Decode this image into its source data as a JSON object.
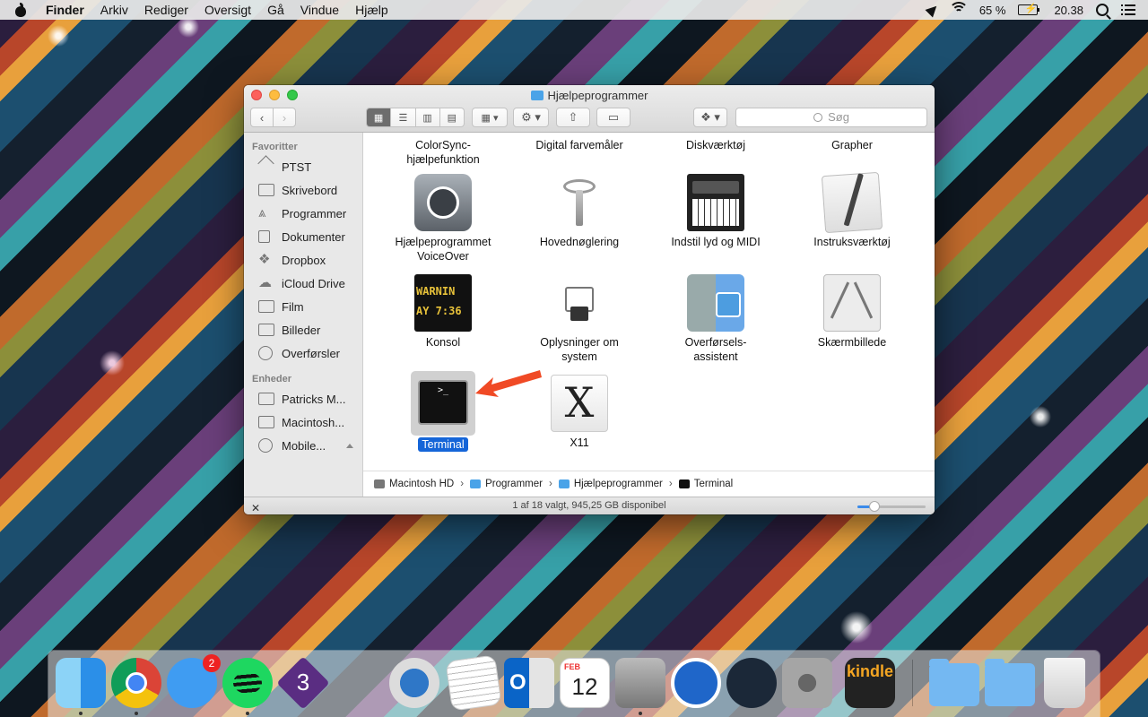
{
  "menubar": {
    "app": "Finder",
    "items": [
      "Arkiv",
      "Rediger",
      "Oversigt",
      "Gå",
      "Vindue",
      "Hjælp"
    ],
    "battery": "65 %",
    "time": "20.38"
  },
  "window": {
    "title": "Hjælpeprogrammer",
    "search_placeholder": "Søg",
    "sidebar": {
      "favorites_header": "Favoritter",
      "favorites": [
        {
          "label": "PTST",
          "icon": "home-icon"
        },
        {
          "label": "Skrivebord",
          "icon": "desktop-icon"
        },
        {
          "label": "Programmer",
          "icon": "applications-icon"
        },
        {
          "label": "Dokumenter",
          "icon": "documents-icon"
        },
        {
          "label": "Dropbox",
          "icon": "dropbox-icon"
        },
        {
          "label": "iCloud Drive",
          "icon": "cloud-icon"
        },
        {
          "label": "Film",
          "icon": "film-icon"
        },
        {
          "label": "Billeder",
          "icon": "camera-icon"
        },
        {
          "label": "Overførsler",
          "icon": "download-icon"
        }
      ],
      "devices_header": "Enheder",
      "devices": [
        {
          "label": "Patricks M...",
          "icon": "laptop-icon"
        },
        {
          "label": "Macintosh...",
          "icon": "harddisk-icon"
        },
        {
          "label": "Mobile...",
          "icon": "disc-icon"
        }
      ]
    },
    "top_row": [
      "ColorSync-hjælpefunktion",
      "Digital farvemåler",
      "Diskværktøj",
      "Grapher"
    ],
    "items": [
      {
        "label": "Hjælpeprogrammet VoiceOver",
        "icon": "voiceover-icon"
      },
      {
        "label": "Hovednøglering",
        "icon": "keychain-icon"
      },
      {
        "label": "Indstil lyd og MIDI",
        "icon": "midi-icon"
      },
      {
        "label": "Instruksværktøj",
        "icon": "script-editor-icon"
      },
      {
        "label": "Konsol",
        "icon": "console-icon",
        "screen_text": "WARNIN AY 7:36"
      },
      {
        "label": "Oplysninger om system",
        "icon": "system-info-icon"
      },
      {
        "label": "Overførsels-assistent",
        "icon": "migration-icon"
      },
      {
        "label": "Skærmbillede",
        "icon": "screenshot-icon"
      },
      {
        "label": "Terminal",
        "icon": "terminal-icon",
        "selected": true,
        "screen_text": ">_"
      },
      {
        "label": "X11",
        "icon": "x11-icon",
        "glyph": "X"
      }
    ],
    "path": [
      "Macintosh HD",
      "Programmer",
      "Hjælpeprogrammer",
      "Terminal"
    ],
    "status": "1 af 18 valgt, 945,25 GB disponibel",
    "icon_size_fraction": 0.25
  },
  "dock": {
    "messages_badge": "2",
    "calendar_month": "FEB",
    "calendar_day": "12",
    "kindle_label": "kindle",
    "three_label": "3",
    "outlook_label": "O"
  },
  "colors": {
    "selection": "#1565d8",
    "arrow": "#f04a25"
  }
}
